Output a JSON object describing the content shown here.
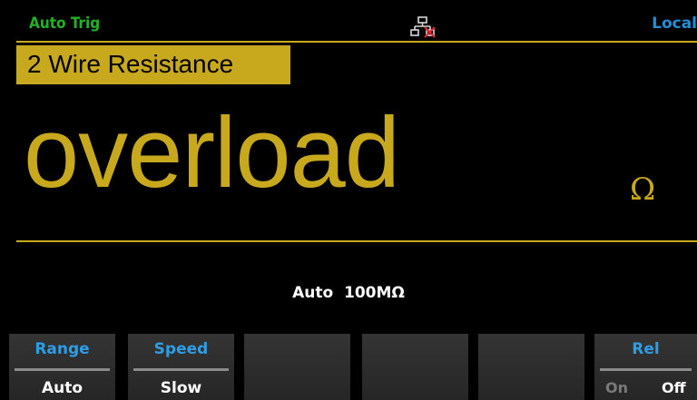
{
  "status": {
    "trigger": "Auto Trig",
    "remote": "Local",
    "network_icon": "lan-disconnected-icon"
  },
  "mode": {
    "label": "2 Wire Resistance"
  },
  "reading": {
    "value": "overload",
    "unit": "Ω"
  },
  "range_info": "Auto  100MΩ",
  "softkeys": {
    "range": {
      "title": "Range",
      "value": "Auto"
    },
    "speed": {
      "title": "Speed",
      "value": "Slow"
    },
    "rel": {
      "title": "Rel",
      "on": "On",
      "off": "Off",
      "selected": "Off"
    }
  },
  "colors": {
    "accent": "#c8a91e",
    "trigger": "#1fb324",
    "label_blue": "#2e9de5",
    "background": "#000000"
  }
}
